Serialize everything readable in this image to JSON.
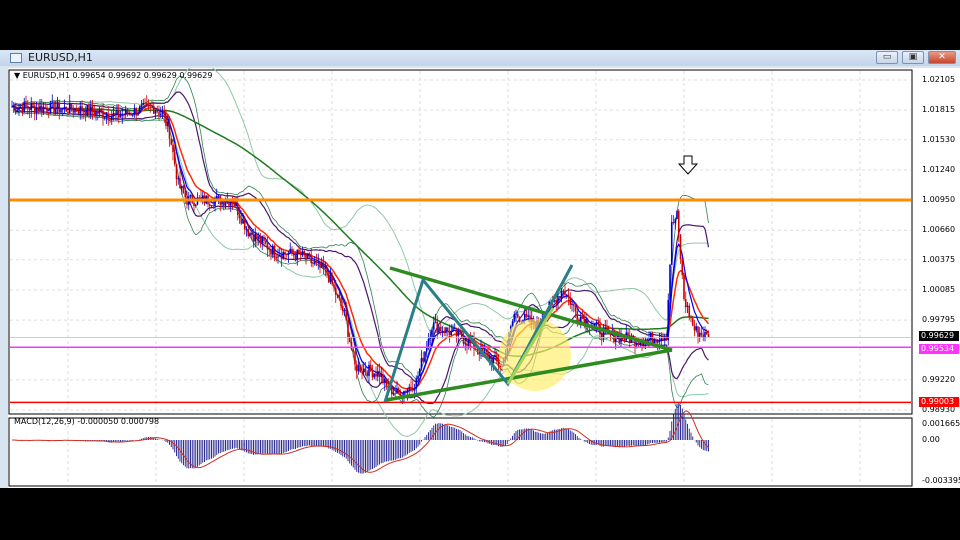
{
  "window": {
    "title": "EURUSD,H1",
    "minimize": "▭",
    "maximize": "▣",
    "close": "✕"
  },
  "chart": {
    "legend": "▼ EURUSD,H1  0.99654 0.99692 0.99629 0.99629",
    "price_axis": [
      "1.02105",
      "1.01815",
      "1.01530",
      "1.01240",
      "1.00950",
      "1.00660",
      "1.00375",
      "1.00085",
      "0.99795",
      "0.99220",
      "0.98930"
    ],
    "tags": {
      "current": "0.99629",
      "magenta": "0.99534",
      "red": "0.99003"
    },
    "macd_legend": "MACD(12,26,9) -0.000050 0.000798",
    "macd_axis": [
      "0.001665",
      "0.00",
      "-0.003395"
    ],
    "colors": {
      "orange": "#ff8c00",
      "magenta": "#ff33ff",
      "red": "#ff0000",
      "trend": "#2e8b20",
      "zigzag": "#2a7f86",
      "highlight": "#ffee66"
    }
  },
  "chart_data": {
    "type": "candlestick",
    "symbol": "EURUSD",
    "timeframe": "H1",
    "ylim": [
      0.9893,
      1.02105
    ],
    "price_waypoints": [
      [
        0,
        1.0185
      ],
      [
        40,
        1.0182
      ],
      [
        60,
        1.0176
      ],
      [
        80,
        1.0185
      ],
      [
        86,
        1.0178
      ],
      [
        90,
        1.016
      ],
      [
        95,
        1.011
      ],
      [
        100,
        1.0095
      ],
      [
        126,
        1.0095
      ],
      [
        135,
        1.0065
      ],
      [
        150,
        1.0045
      ],
      [
        165,
        1.0042
      ],
      [
        180,
        1.0025
      ],
      [
        190,
        0.9985
      ],
      [
        196,
        0.9935
      ],
      [
        210,
        0.9928
      ],
      [
        214,
        0.9915
      ],
      [
        221,
        0.9908
      ],
      [
        231,
        0.992
      ],
      [
        240,
        0.9975
      ],
      [
        255,
        0.9965
      ],
      [
        268,
        0.995
      ],
      [
        280,
        0.9935
      ],
      [
        287,
        0.9985
      ],
      [
        300,
        0.9975
      ],
      [
        315,
        1.001
      ],
      [
        323,
        0.9985
      ],
      [
        340,
        0.9965
      ],
      [
        360,
        0.996
      ],
      [
        374,
        0.9965
      ],
      [
        377,
        1.007
      ],
      [
        380,
        1.008
      ],
      [
        384,
        1.0
      ],
      [
        390,
        0.997
      ],
      [
        398,
        0.99629
      ]
    ],
    "levels": {
      "resistance": 1.0095,
      "support_mid": 0.99534,
      "support_low": 0.99003
    }
  }
}
